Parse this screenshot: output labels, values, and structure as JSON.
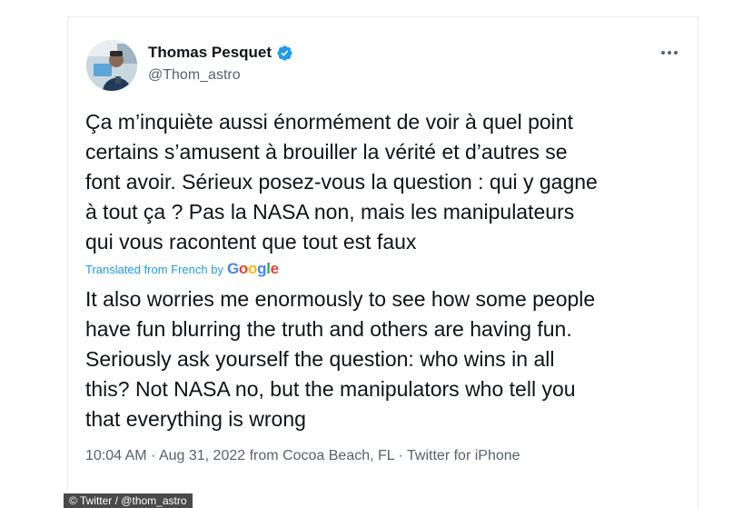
{
  "author": {
    "display_name": "Thomas Pesquet",
    "handle": "@Thom_astro",
    "avatar_icon": "astronaut-photo-avatar",
    "verified_icon": "verified-badge-icon",
    "verified_color": "#1d9bf0"
  },
  "menu": {
    "more_icon": "more-horizontal-icon"
  },
  "tweet": {
    "text": "Ça m’inquiète aussi énormément de voir à quel point\ncertains s’amusent à brouiller la vérité et d’autres se\nfont avoir. Sérieux posez-vous la question : qui y gagne\nà tout ça ? Pas la NASA non, mais les manipulateurs\nqui vous racontent que tout est faux",
    "translated_label": "Translated from French by",
    "translation_provider": "Google",
    "translation": "It also worries me enormously to see how some people\nhave fun blurring the truth and others are having fun.\nSeriously ask yourself the question: who wins in all\nthis? Not NASA no, but the manipulators who tell you\nthat everything is wrong",
    "time": "10:04 AM",
    "date": "Aug 31, 2022",
    "location_prefix": "from",
    "location": "Cocoa Beach, FL",
    "source": "Twitter for iPhone",
    "separator": "·"
  },
  "credit": "© Twitter / @thom_astro",
  "colors": {
    "text": "#0f1419",
    "secondary": "#536471",
    "link": "#1d9bf0",
    "google_blue": "#4285f4",
    "google_red": "#ea4335",
    "google_yellow": "#fbbc05",
    "google_green": "#34a853"
  }
}
